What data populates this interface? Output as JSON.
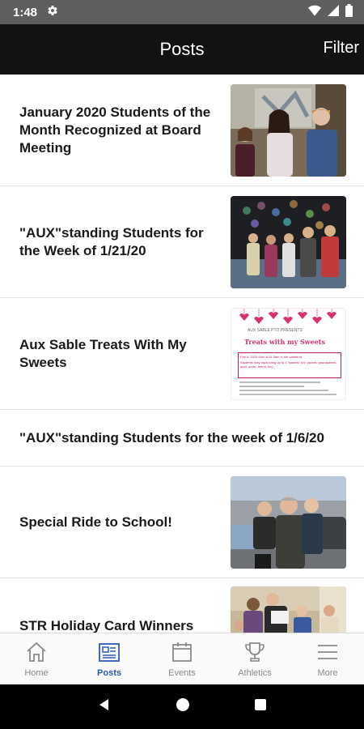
{
  "status": {
    "time": "1:48"
  },
  "header": {
    "title": "Posts",
    "filter_label": "Filter"
  },
  "posts": [
    {
      "title": "January 2020 Students of the Month Recognized at Board Meeting"
    },
    {
      "title": "\"AUX\"standing Students for the Week of 1/21/20"
    },
    {
      "title": "Aux Sable Treats With My Sweets"
    },
    {
      "title": "\"AUX\"standing Students for the week of 1/6/20"
    },
    {
      "title": "Special Ride to School!"
    },
    {
      "title": "STR Holiday Card Winners"
    }
  ],
  "flyer": {
    "presents": "AUX SABLE PTO PRESENTS",
    "title": "Treats with my Sweets",
    "line1": "Feb 6, 2020 from 8:15-9am in the cafeteria",
    "line2": "Students may each bring up to 4 \"sweets\" (ex: parent, grandparent, aunt, uncle, friend, etc)"
  },
  "tabs": [
    {
      "label": "Home",
      "icon": "home-icon"
    },
    {
      "label": "Posts",
      "icon": "posts-icon"
    },
    {
      "label": "Events",
      "icon": "calendar-icon"
    },
    {
      "label": "Athletics",
      "icon": "trophy-icon"
    },
    {
      "label": "More",
      "icon": "menu-icon"
    }
  ],
  "colors": {
    "accent": "#2d5bb8",
    "header_bg": "#121212",
    "status_bg": "#5e5e5e"
  }
}
